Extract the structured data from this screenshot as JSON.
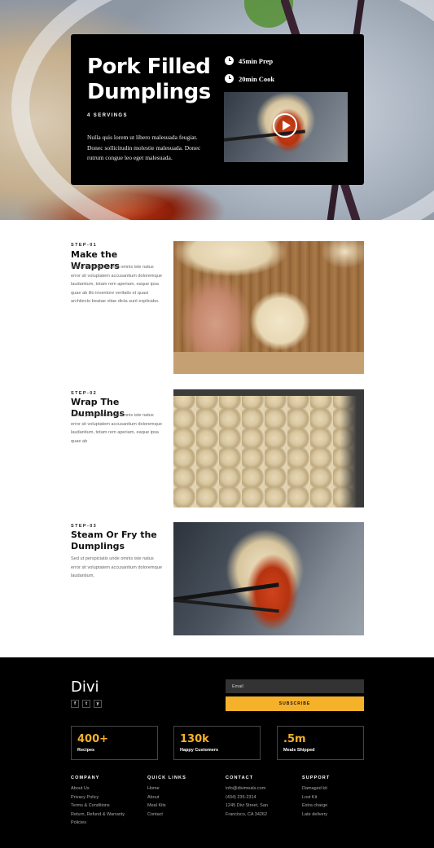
{
  "hero": {
    "title": "Pork Filled Dumplings",
    "servings": "4 SERVINGS",
    "description": "Nulla quis lorem ut libero malesuada feugiat. Donec sollicitudin molestie malesuada. Donec rutrum congue leo eget malesuada.",
    "prep_time": "45min Prep",
    "cook_time": "20min Cook"
  },
  "steps": [
    {
      "label": "STEP-01",
      "title": "Make the Wrappers",
      "text": "Sed ut perspiciatis unde omnis iste natus error sit voluptatem accusantium doloremque laudantium, totam rem aperiam, eaque ipsa quae ab illo inventore veritatis et quasi architecto beatae vitae dicta sunt explicabo."
    },
    {
      "label": "STEP-02",
      "title": "Wrap The Dumplings",
      "text": "Sed ut perspiciatis unde omnis iste natus error sit voluptatem accusantium doloremque laudantium, totam rem aperiam, eaque ipsa quae ab"
    },
    {
      "label": "STEP-03",
      "title": "Steam Or Fry the Dumplings",
      "text": "Sed ut perspiciatis unde omnis iste natus error sit voluptatem accusantium doloremque laudantium,"
    }
  ],
  "footer": {
    "brand": "Divi",
    "social": [
      "f",
      "t",
      "y"
    ],
    "email_placeholder": "Email",
    "subscribe_label": "SUBSCRIBE",
    "accent_color": "#f6b12a",
    "stats": [
      {
        "value": "400+",
        "label": "Recipes"
      },
      {
        "value": "130k",
        "label": "Happy Customers"
      },
      {
        "value": ".5m",
        "label": "Meals Shipped"
      }
    ],
    "columns": [
      {
        "heading": "COMPANY",
        "items": [
          "About Us",
          "Privacy Policy",
          "Terms & Conditions",
          "Return, Refund & Warranty Policies"
        ]
      },
      {
        "heading": "QUICK LINKS",
        "items": [
          "Home",
          "About",
          "Meal Kits",
          "Contact"
        ]
      },
      {
        "heading": "CONTACT",
        "items": [
          "info@divimeals.com",
          "(434) 235-2314",
          "1245 Divi Street, San Francisco, CA 34262"
        ]
      },
      {
        "heading": "SUPPORT",
        "items": [
          "Damaged kit",
          "Lost Kit",
          "Extra charge",
          "Late delivery"
        ]
      }
    ]
  }
}
